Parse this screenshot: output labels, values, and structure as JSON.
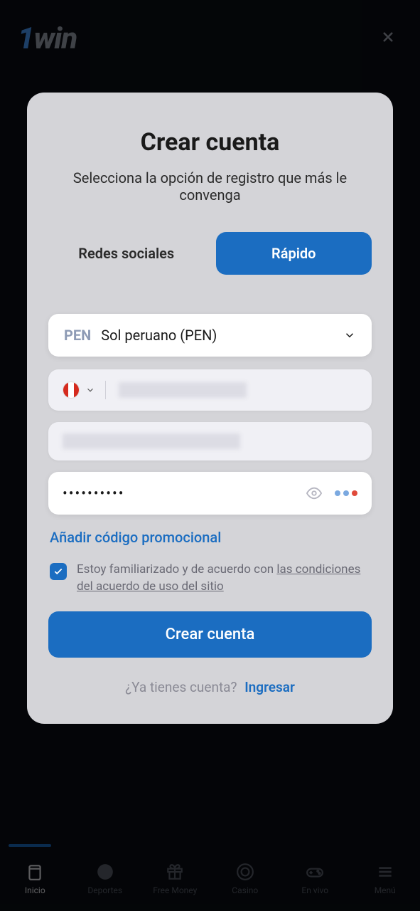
{
  "header": {
    "logo_prefix": "1",
    "logo_main": "win"
  },
  "modal": {
    "title": "Crear cuenta",
    "subtitle": "Selecciona la opción de registro que más le convenga",
    "tabs": {
      "social": "Redes sociales",
      "quick": "Rápido"
    },
    "currency": {
      "code": "PEN",
      "name": "Sol peruano (PEN)"
    },
    "password_mask": "••••••••••",
    "promo_link": "Añadir código promocional",
    "terms_prefix": "Estoy familiarizado y de acuerdo con ",
    "terms_link": "las condiciones del acuerdo de uso del sitio",
    "create_button": "Crear cuenta",
    "login_prompt": "¿Ya tienes cuenta?",
    "login_link": "Ingresar"
  },
  "nav": {
    "inicio": "Inicio",
    "deportes": "Deportes",
    "freemoney": "Free Money",
    "casino": "Casino",
    "envivo": "En vivo",
    "menu": "Menú"
  }
}
